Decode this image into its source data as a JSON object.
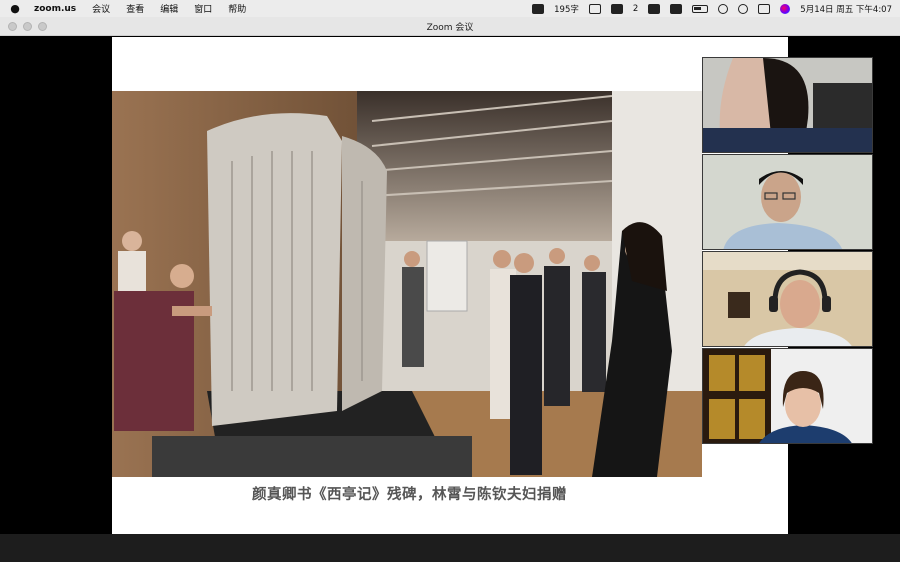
{
  "menubar": {
    "app_name": "zoom.us",
    "menus": [
      "会议",
      "查看",
      "编辑",
      "窗口",
      "帮助"
    ],
    "status": {
      "count_text": "195字",
      "wechat_badge": "2",
      "datetime": "5月14日 周五 下午4:07"
    }
  },
  "window": {
    "title": "Zoom 会议"
  },
  "slide": {
    "caption": "颜真卿书《西亭记》残碑，林霄与陈钦夫妇捐赠"
  },
  "colors": {
    "caption": "#555555",
    "menubar_bg": "#ececec",
    "titlebar_bg": "#e6e6e6"
  }
}
